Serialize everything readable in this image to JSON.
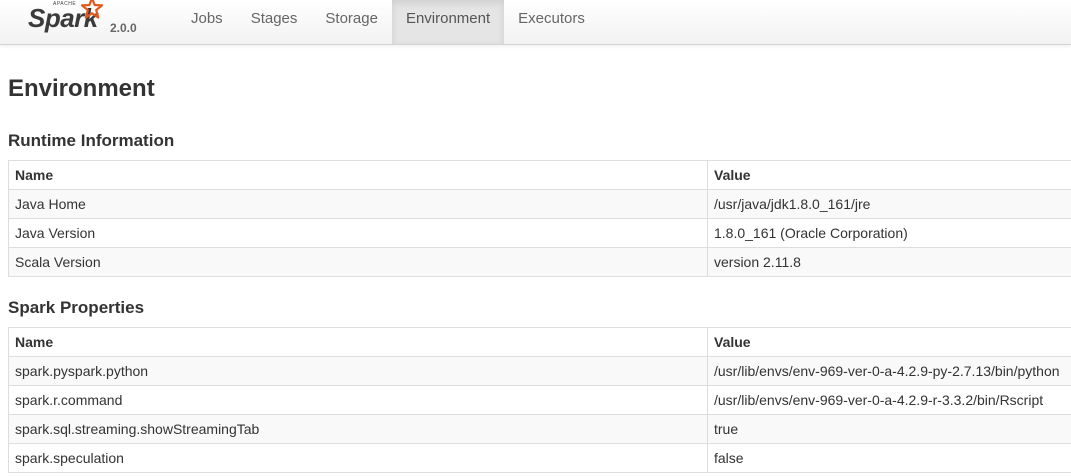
{
  "brand": {
    "apache": "APACHE",
    "name": "Spark",
    "version": "2.0.0"
  },
  "nav": {
    "items": [
      {
        "label": "Jobs",
        "active": false
      },
      {
        "label": "Stages",
        "active": false
      },
      {
        "label": "Storage",
        "active": false
      },
      {
        "label": "Environment",
        "active": true
      },
      {
        "label": "Executors",
        "active": false
      }
    ]
  },
  "page": {
    "title": "Environment"
  },
  "runtime": {
    "heading": "Runtime Information",
    "columns": [
      "Name",
      "Value"
    ],
    "rows": [
      [
        "Java Home",
        "/usr/java/jdk1.8.0_161/jre"
      ],
      [
        "Java Version",
        "1.8.0_161 (Oracle Corporation)"
      ],
      [
        "Scala Version",
        "version 2.11.8"
      ]
    ]
  },
  "spark_properties": {
    "heading": "Spark Properties",
    "columns": [
      "Name",
      "Value"
    ],
    "rows": [
      [
        "spark.pyspark.python",
        "/usr/lib/envs/env-969-ver-0-a-4.2.9-py-2.7.13/bin/python"
      ],
      [
        "spark.r.command",
        "/usr/lib/envs/env-969-ver-0-a-4.2.9-r-3.3.2/bin/Rscript"
      ],
      [
        "spark.sql.streaming.showStreamingTab",
        "true"
      ],
      [
        "spark.speculation",
        "false"
      ]
    ]
  },
  "colors": {
    "logo_orange": "#e25a1c",
    "active_tab_bg": "#e5e5e5",
    "table_border": "#dddddd",
    "stripe": "#f9f9f9"
  }
}
